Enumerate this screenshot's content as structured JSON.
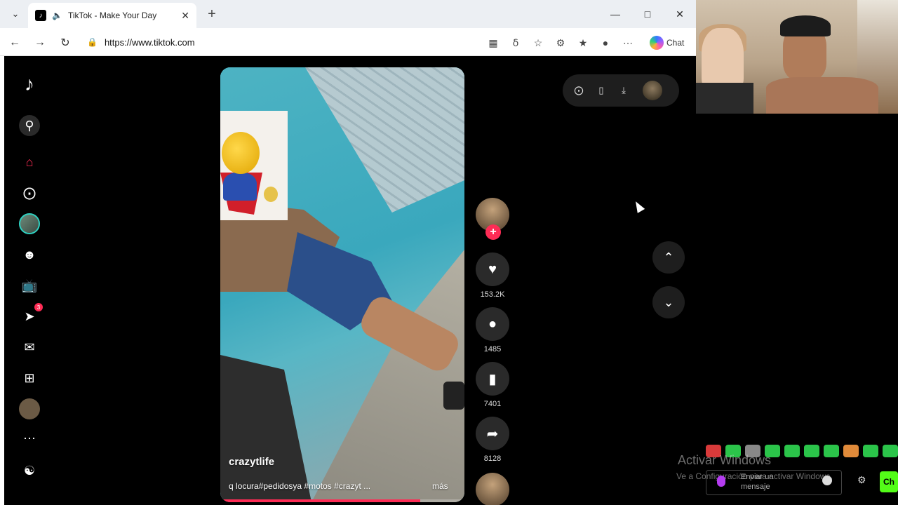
{
  "browser": {
    "tab_title": "TikTok - Make Your Day",
    "url": "https://www.tiktok.com",
    "chat_label": "Chat"
  },
  "sidebar": {
    "icons": [
      "tiktok-logo",
      "search-icon",
      "home-icon",
      "explore-icon",
      "profile-avatar",
      "friends-icon",
      "live-icon",
      "messages-icon",
      "inbox-icon",
      "upload-icon",
      "avatar",
      "more-icon",
      "settings-icon"
    ],
    "messages_badge": "3"
  },
  "video": {
    "username": "crazytlife",
    "description": "q locura#pedidosya #motos #crazyt ...",
    "more_label": "más",
    "progress": 0.82
  },
  "actions": {
    "likes": "153.2K",
    "comments": "1485",
    "saves": "7401",
    "shares": "8128"
  },
  "overlay": {
    "activate_title": "Activar Windows",
    "activate_sub": "Ve a Configuración para activar Windows.",
    "message_placeholder": "Enviar un mensaje",
    "send_label": "Ch"
  },
  "colors": {
    "tiktok_red": "#fe2c55",
    "kick_green": "#53fc18"
  }
}
